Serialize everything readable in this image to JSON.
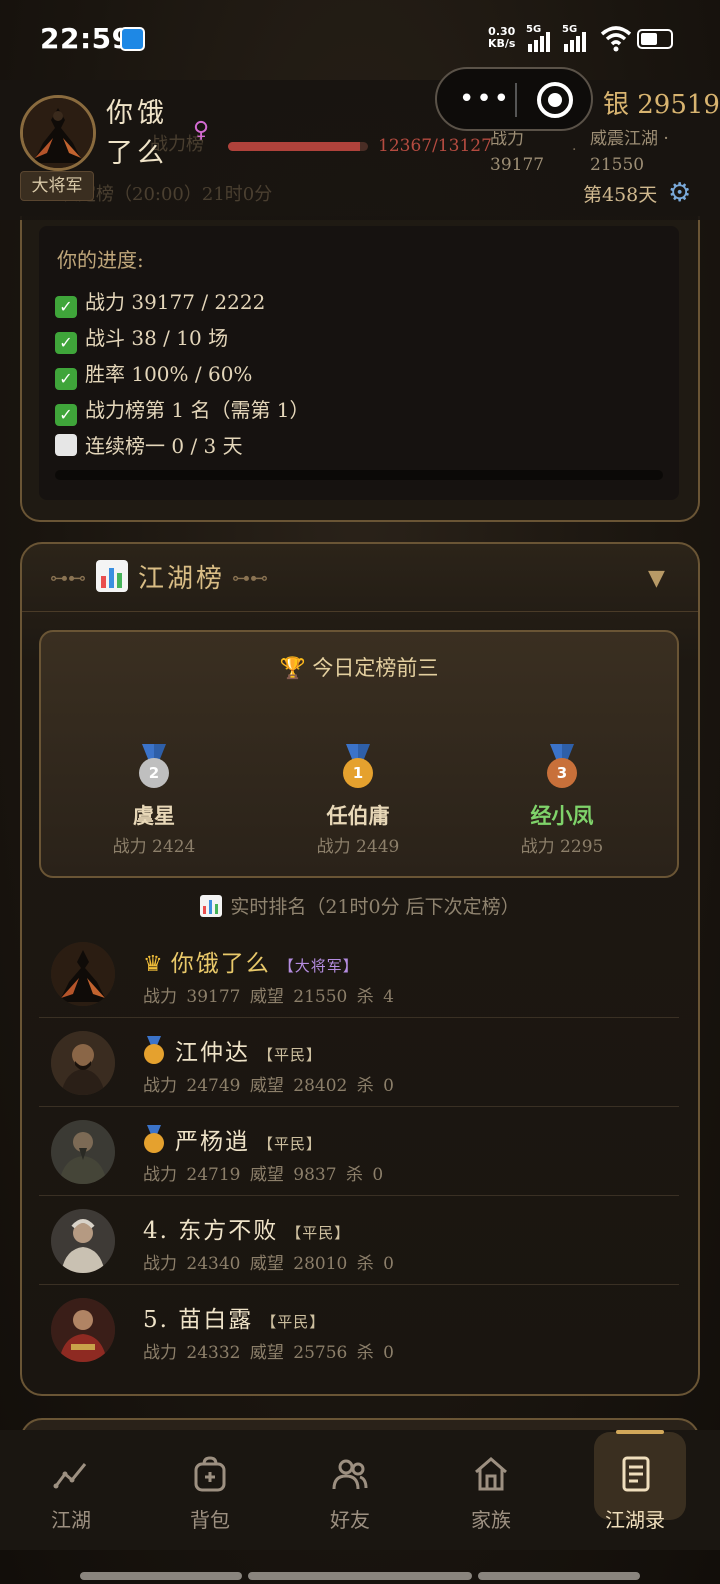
{
  "status_bar": {
    "time": "22:59",
    "net_speed": "0.30",
    "net_unit": "KB/s",
    "sig1": "5G",
    "sig2": "5G"
  },
  "header": {
    "player_name": "你饿了么",
    "rank_title": "大将军",
    "gender_symbol": "♀",
    "hp_text": "12367/13127",
    "hp_fraction": 0.94,
    "power_label": "战力",
    "power_value": "39177",
    "fame_label": "威震江湖 ·",
    "fame_value": "21550",
    "silver": "银 29519",
    "day": "第458天",
    "settings_icon": "gear-icon",
    "ghost1": "战力榜",
    "ghost2": "次定榜（20:00）21时0分"
  },
  "progress": {
    "label": "你的进度:",
    "items": [
      {
        "done": true,
        "text": "战力 39177 / 2222"
      },
      {
        "done": true,
        "text": "战斗 38 / 10 场"
      },
      {
        "done": true,
        "text": "胜率 100% / 60%"
      },
      {
        "done": true,
        "text": "战力榜第 1 名（需第 1）"
      },
      {
        "done": false,
        "text": "连续榜一 0 / 3 天"
      }
    ],
    "bar_fraction": 0
  },
  "ranking": {
    "title": "江湖榜",
    "top3_title": "🏆 今日定榜前三",
    "podium": [
      {
        "place": "2",
        "name": "虞星",
        "power": "战力 2424",
        "color": "#bfbfbf",
        "name_color": "#e8d8b8"
      },
      {
        "place": "1",
        "name": "任伯庸",
        "power": "战力 2449",
        "color": "#e5a12e",
        "name_color": "#e8d8b8"
      },
      {
        "place": "3",
        "name": "经小凤",
        "power": "战力 2295",
        "color": "#c8703a",
        "name_color": "#7fd36a"
      }
    ],
    "live_label": "实时排名（21时0分 后下次定榜）",
    "rows": [
      {
        "prefix": "👑",
        "name": "你饿了么",
        "badge": "【大将军】",
        "badge_color": "#b58de0",
        "name_color": "#e9c96a",
        "stats": "战力 39177  威望 21550  杀 4"
      },
      {
        "prefix": "medal",
        "name": "江仲达",
        "badge": "【平民】",
        "badge_color": "#cdbf9f",
        "name_color": "#efe3c8",
        "stats": "战力 24749  威望 28402  杀 0"
      },
      {
        "prefix": "medal",
        "name": "严杨逍",
        "badge": "【平民】",
        "badge_color": "#cdbf9f",
        "name_color": "#efe3c8",
        "stats": "战力 24719  威望 9837  杀 0"
      },
      {
        "prefix": "4.",
        "name": "东方不败",
        "badge": "【平民】",
        "badge_color": "#cdbf9f",
        "name_color": "#efe3c8",
        "stats": "战力 24340  威望 28010  杀 0"
      },
      {
        "prefix": "5.",
        "name": "苗白露",
        "badge": "【平民】",
        "badge_color": "#cdbf9f",
        "name_color": "#efe3c8",
        "stats": "战力 24332  威望 25756  杀 0"
      }
    ]
  },
  "tabs": [
    {
      "label": "江湖",
      "icon": "chart-line-icon"
    },
    {
      "label": "背包",
      "icon": "bag-icon"
    },
    {
      "label": "好友",
      "icon": "friends-icon"
    },
    {
      "label": "家族",
      "icon": "home-icon"
    },
    {
      "label": "江湖录",
      "icon": "document-icon",
      "active": true
    }
  ]
}
